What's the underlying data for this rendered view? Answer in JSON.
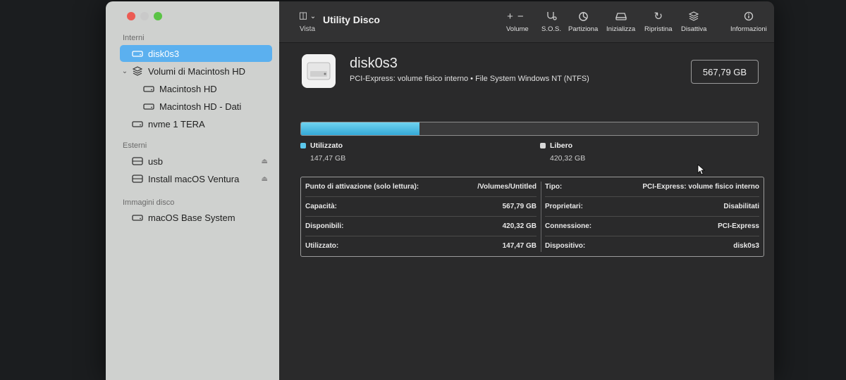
{
  "sidebar": {
    "sections": [
      {
        "title": "Interni"
      },
      {
        "title": "Esterni"
      },
      {
        "title": "Immagini disco"
      }
    ],
    "items": [
      {
        "label": "disk0s3",
        "icon": "internal-drive-icon"
      },
      {
        "label": "Volumi di Macintosh HD",
        "icon": "volume-stack-icon"
      },
      {
        "label": "Macintosh HD",
        "icon": "internal-drive-icon"
      },
      {
        "label": "Macintosh HD - Dati",
        "icon": "internal-drive-icon"
      },
      {
        "label": "nvme 1 TERA",
        "icon": "internal-drive-icon"
      },
      {
        "label": "usb",
        "icon": "external-drive-icon"
      },
      {
        "label": "Install macOS Ventura",
        "icon": "external-drive-icon"
      },
      {
        "label": "macOS Base System",
        "icon": "disk-image-icon"
      }
    ],
    "eject_glyph": "⏏"
  },
  "toolbar": {
    "view_label": "Vista",
    "title": "Utility Disco",
    "buttons": [
      {
        "label": "Volume",
        "icon": "plus-minus-icon"
      },
      {
        "label": "S.O.S.",
        "icon": "stethoscope-icon"
      },
      {
        "label": "Partiziona",
        "icon": "pie-partition-icon"
      },
      {
        "label": "Inizializza",
        "icon": "erase-icon"
      },
      {
        "label": "Ripristina",
        "icon": "restore-icon"
      },
      {
        "label": "Disattiva",
        "icon": "unmount-icon"
      },
      {
        "label": "Informazioni",
        "icon": "info-icon"
      }
    ]
  },
  "disk": {
    "name": "disk0s3",
    "subtitle": "PCI-Express: volume fisico interno • File System Windows NT (NTFS)",
    "capacity": "567,79 GB",
    "used_fraction": 0.26
  },
  "usage": {
    "used_label": "Utilizzato",
    "used_value": "147,47 GB",
    "free_label": "Libero",
    "free_value": "420,32 GB",
    "used_color": "#5bc8ec",
    "free_color": "#d8d8d8"
  },
  "info": {
    "left": [
      {
        "key": "Punto di attivazione (solo lettura):",
        "value": "/Volumes/Untitled"
      },
      {
        "key": "Capacità:",
        "value": "567,79 GB"
      },
      {
        "key": "Disponibili:",
        "value": "420,32 GB"
      },
      {
        "key": "Utilizzato:",
        "value": "147,47 GB"
      }
    ],
    "right": [
      {
        "key": "Tipo:",
        "value": "PCI-Express: volume fisico interno"
      },
      {
        "key": "Proprietari:",
        "value": "Disabilitati"
      },
      {
        "key": "Connessione:",
        "value": "PCI-Express"
      },
      {
        "key": "Dispositivo:",
        "value": "disk0s3"
      }
    ]
  }
}
